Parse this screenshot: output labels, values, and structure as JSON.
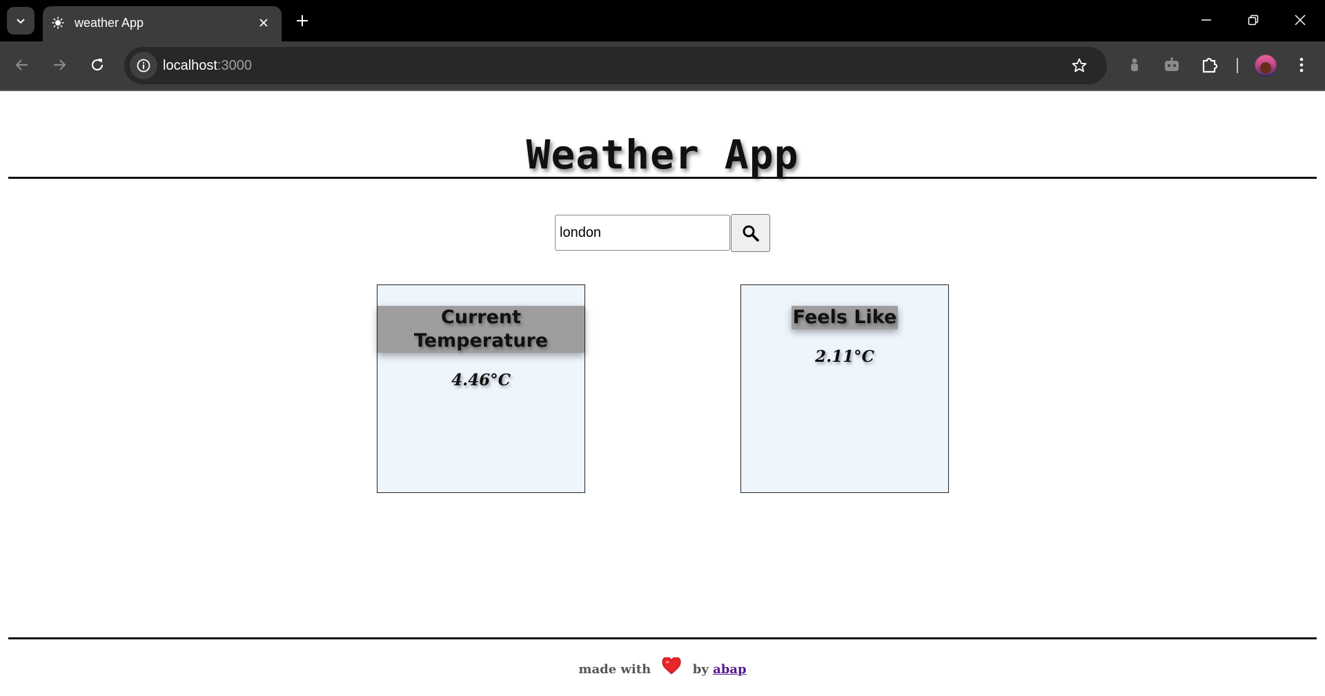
{
  "browser": {
    "tab": {
      "title": "weather App",
      "favicon": "sun-favicon-icon"
    },
    "address": {
      "host": "localhost",
      "port": ":3000"
    },
    "icons": [
      "tab-search-icon",
      "close-icon",
      "new-tab-icon",
      "minimize-icon",
      "restore-icon",
      "window-close-icon",
      "back-icon",
      "forward-icon",
      "reload-icon",
      "site-info-icon",
      "bookmark-star-icon",
      "extension-icon",
      "puzzle-extensions-icon",
      "profile-avatar",
      "more-menu-icon"
    ]
  },
  "app": {
    "title": "Weather App",
    "search": {
      "value": "london",
      "button_icon": "search-icon"
    },
    "cards": [
      {
        "title": "Current Temperature",
        "value": "4.46°C"
      },
      {
        "title": "Feels Like",
        "value": "2.11°C"
      }
    ],
    "footer": {
      "prefix": "made with",
      "heart_icon": "heart-icon",
      "by": "by",
      "author": "abap"
    }
  },
  "colors": {
    "card_background": "#eef5fd",
    "card_title_highlight": "#9e9e9e",
    "chrome_dark": "#3c3c3c",
    "heart": "#e8262b"
  }
}
